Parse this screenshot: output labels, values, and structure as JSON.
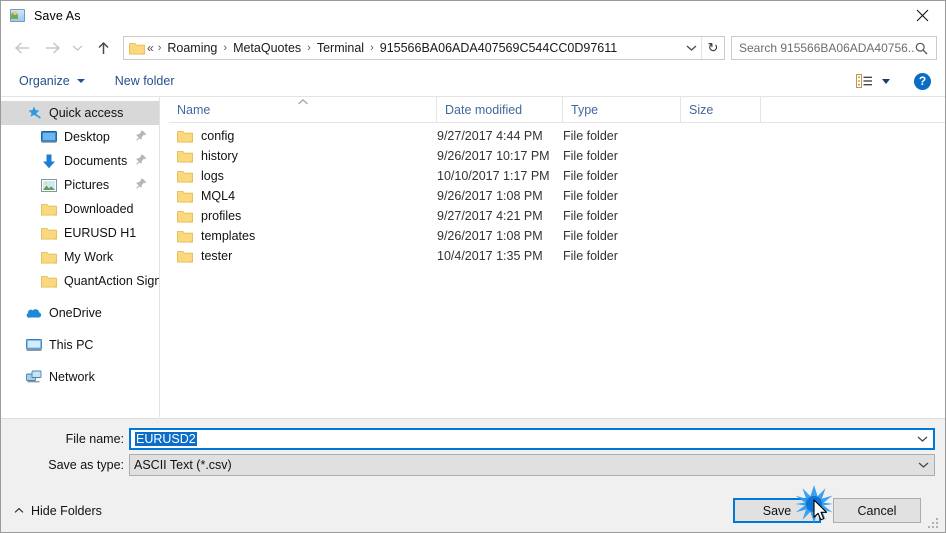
{
  "window": {
    "title": "Save As",
    "title_icon": "photo-person-icon",
    "close_label": "✕"
  },
  "nav": {
    "back": "back-arrow",
    "forward": "forward-arrow",
    "recent": "recent-locations-chevron",
    "up": "up-arrow",
    "breadcrumb_prefix": "«",
    "crumbs": [
      "Roaming",
      "MetaQuotes",
      "Terminal",
      "915566BA06ADA407569C544CC0D97611"
    ],
    "separator": "›",
    "dropdown": "chevron-down-icon",
    "refresh": "↻"
  },
  "search": {
    "placeholder": "Search 915566BA06ADA40756...",
    "icon": "search-icon"
  },
  "toolbar": {
    "organize": "Organize",
    "new_folder": "New folder",
    "view_icon": "list-view-icon",
    "help": "?"
  },
  "sidebar": {
    "items": [
      {
        "label": "Quick access",
        "icon": "star-pin-icon",
        "level": 0,
        "selected": true,
        "pinned": false
      },
      {
        "label": "Desktop",
        "icon": "desktop-icon",
        "level": 1,
        "selected": false,
        "pinned": true
      },
      {
        "label": "Documents",
        "icon": "documents-down-arrow-icon",
        "level": 1,
        "selected": false,
        "pinned": true
      },
      {
        "label": "Pictures",
        "icon": "pictures-icon",
        "level": 1,
        "selected": false,
        "pinned": true
      },
      {
        "label": "Downloaded",
        "icon": "folder-icon",
        "level": 1,
        "selected": false,
        "pinned": false
      },
      {
        "label": "EURUSD H1",
        "icon": "folder-icon",
        "level": 1,
        "selected": false,
        "pinned": false
      },
      {
        "label": "My Work",
        "icon": "folder-icon",
        "level": 1,
        "selected": false,
        "pinned": false
      },
      {
        "label": "QuantAction Signal",
        "icon": "folder-icon",
        "level": 1,
        "selected": false,
        "pinned": false
      },
      {
        "label": "OneDrive",
        "icon": "onedrive-cloud-icon",
        "level": 0,
        "selected": false,
        "pinned": false,
        "gap_before": true
      },
      {
        "label": "This PC",
        "icon": "this-pc-icon",
        "level": 0,
        "selected": false,
        "pinned": false,
        "gap_before": true
      },
      {
        "label": "Network",
        "icon": "network-icon",
        "level": 0,
        "selected": false,
        "pinned": false,
        "gap_before": true
      }
    ]
  },
  "filelist": {
    "columns": [
      "Name",
      "Date modified",
      "Type",
      "Size"
    ],
    "sort_column": "Name",
    "sort_direction": "ascending",
    "rows": [
      {
        "name": "config",
        "date": "9/27/2017 4:44 PM",
        "type": "File folder",
        "size": ""
      },
      {
        "name": "history",
        "date": "9/26/2017 10:17 PM",
        "type": "File folder",
        "size": ""
      },
      {
        "name": "logs",
        "date": "10/10/2017 1:17 PM",
        "type": "File folder",
        "size": ""
      },
      {
        "name": "MQL4",
        "date": "9/26/2017 1:08 PM",
        "type": "File folder",
        "size": ""
      },
      {
        "name": "profiles",
        "date": "9/27/2017 4:21 PM",
        "type": "File folder",
        "size": ""
      },
      {
        "name": "templates",
        "date": "9/26/2017 1:08 PM",
        "type": "File folder",
        "size": ""
      },
      {
        "name": "tester",
        "date": "10/4/2017 1:35 PM",
        "type": "File folder",
        "size": ""
      }
    ]
  },
  "form": {
    "file_name_label": "File name:",
    "file_name_value": "EURUSD2",
    "save_as_type_label": "Save as type:",
    "save_as_type_value": "ASCII Text (*.csv)"
  },
  "footer": {
    "hide_folders": "Hide Folders",
    "save": "Save",
    "cancel": "Cancel"
  },
  "colors": {
    "accent": "#0078d7",
    "link": "#26508d",
    "folder": "#fbd77d",
    "selection": "#0b6dc7",
    "help": "#0a6cc4"
  }
}
